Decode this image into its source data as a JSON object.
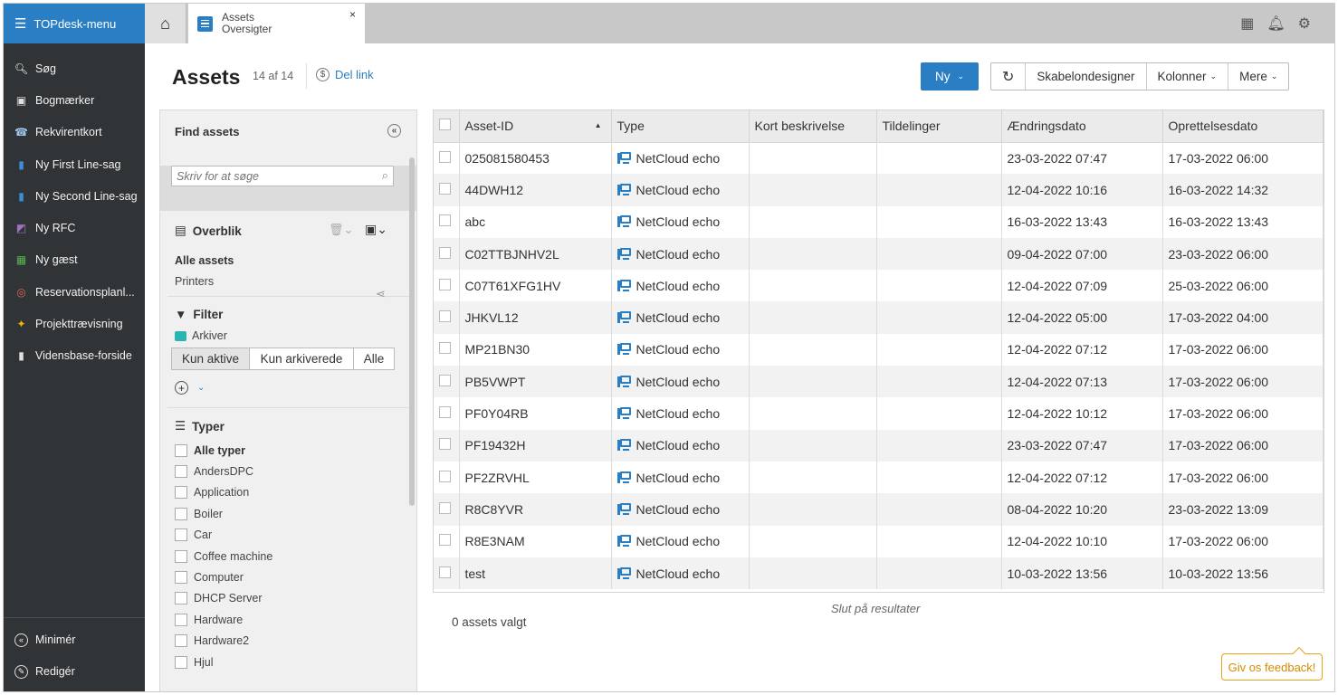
{
  "sidebar": {
    "menu_label": "TOPdesk-menu",
    "items": [
      {
        "label": "Søg",
        "icon": "search-icon",
        "color": "#ffffff"
      },
      {
        "label": "Bogmærker",
        "icon": "bookmark-icon",
        "color": "#e0e0e0"
      },
      {
        "label": "Rekvirentkort",
        "icon": "caller-card-icon",
        "color": "#9ec7ef"
      },
      {
        "label": "Ny First Line-sag",
        "icon": "first-line-call-icon",
        "color": "#3a8fd6"
      },
      {
        "label": "Ny Second Line-sag",
        "icon": "second-line-call-icon",
        "color": "#3a8fd6"
      },
      {
        "label": "Ny RFC",
        "icon": "rfc-icon",
        "color": "#a070c0"
      },
      {
        "label": "Ny gæst",
        "icon": "guest-icon",
        "color": "#5bb04f"
      },
      {
        "label": "Reservationsplanl...",
        "icon": "reservation-icon",
        "color": "#e0645a"
      },
      {
        "label": "Projekttrævisning",
        "icon": "project-tree-icon",
        "color": "#f0b400"
      },
      {
        "label": "Vidensbase-forside",
        "icon": "knowledge-base-icon",
        "color": "#e0e0e0"
      }
    ],
    "bottom": [
      {
        "label": "Minimér",
        "icon": "minimize-icon"
      },
      {
        "label": "Redigér",
        "icon": "edit-icon"
      }
    ]
  },
  "tabbar": {
    "tab_title": "Assets",
    "tab_subtitle": "Oversigter",
    "close": "×"
  },
  "header": {
    "title": "Assets",
    "count": "14 af 14",
    "share_link": "Del link",
    "new_button": "Ny",
    "buttons": [
      "Skabelondesigner",
      "Kolonner",
      "Mere"
    ]
  },
  "panel": {
    "title": "Find assets",
    "search_placeholder": "Skriv for at søge",
    "overview": {
      "title": "Overblik",
      "all_assets": "Alle assets",
      "printers": "Printers"
    },
    "filter": {
      "title": "Filter",
      "archive_label": "Arkiver",
      "options": [
        "Kun aktive",
        "Kun arkiverede",
        "Alle"
      ],
      "active_option": "Kun aktive"
    },
    "types": {
      "title": "Typer",
      "all_types": "Alle typer",
      "items": [
        "AndersDPC",
        "Application",
        "Boiler",
        "Car",
        "Coffee machine",
        "Computer",
        "DHCP Server",
        "Hardware",
        "Hardware2",
        "Hjul"
      ]
    }
  },
  "table": {
    "columns": [
      "Asset-ID",
      "Type",
      "Kort beskrivelse",
      "Tildelinger",
      "Ændringsdato",
      "Oprettelsesdato"
    ],
    "rows": [
      {
        "id": "025081580453",
        "type": "NetCloud echo",
        "desc": "",
        "assign": "",
        "changed": "23-03-2022 07:47",
        "created": "17-03-2022 06:00"
      },
      {
        "id": "44DWH12",
        "type": "NetCloud echo",
        "desc": "",
        "assign": "",
        "changed": "12-04-2022 10:16",
        "created": "16-03-2022 14:32"
      },
      {
        "id": "abc",
        "type": "NetCloud echo",
        "desc": "",
        "assign": "",
        "changed": "16-03-2022 13:43",
        "created": "16-03-2022 13:43"
      },
      {
        "id": "C02TTBJNHV2L",
        "type": "NetCloud echo",
        "desc": "",
        "assign": "",
        "changed": "09-04-2022 07:00",
        "created": "23-03-2022 06:00"
      },
      {
        "id": "C07T61XFG1HV",
        "type": "NetCloud echo",
        "desc": "",
        "assign": "",
        "changed": "12-04-2022 07:09",
        "created": "25-03-2022 06:00"
      },
      {
        "id": "JHKVL12",
        "type": "NetCloud echo",
        "desc": "",
        "assign": "",
        "changed": "12-04-2022 05:00",
        "created": "17-03-2022 04:00"
      },
      {
        "id": "MP21BN30",
        "type": "NetCloud echo",
        "desc": "",
        "assign": "",
        "changed": "12-04-2022 07:12",
        "created": "17-03-2022 06:00"
      },
      {
        "id": "PB5VWPT",
        "type": "NetCloud echo",
        "desc": "",
        "assign": "",
        "changed": "12-04-2022 07:13",
        "created": "17-03-2022 06:00"
      },
      {
        "id": "PF0Y04RB",
        "type": "NetCloud echo",
        "desc": "",
        "assign": "",
        "changed": "12-04-2022 10:12",
        "created": "17-03-2022 06:00"
      },
      {
        "id": "PF19432H",
        "type": "NetCloud echo",
        "desc": "",
        "assign": "",
        "changed": "23-03-2022 07:47",
        "created": "17-03-2022 06:00"
      },
      {
        "id": "PF2ZRVHL",
        "type": "NetCloud echo",
        "desc": "",
        "assign": "",
        "changed": "12-04-2022 07:12",
        "created": "17-03-2022 06:00"
      },
      {
        "id": "R8C8YVR",
        "type": "NetCloud echo",
        "desc": "",
        "assign": "",
        "changed": "08-04-2022 10:20",
        "created": "23-03-2022 13:09"
      },
      {
        "id": "R8E3NAM",
        "type": "NetCloud echo",
        "desc": "",
        "assign": "",
        "changed": "12-04-2022 10:10",
        "created": "17-03-2022 06:00"
      },
      {
        "id": "test",
        "type": "NetCloud echo",
        "desc": "",
        "assign": "",
        "changed": "10-03-2022 13:56",
        "created": "10-03-2022 13:56"
      }
    ],
    "end_text": "Slut på resultater",
    "selected_text": "0 assets valgt"
  },
  "feedback": "Giv os feedback!",
  "colors": {
    "sidebar_bg": "#303436",
    "accent": "#2a7fc4",
    "feedback": "#e8a317"
  }
}
